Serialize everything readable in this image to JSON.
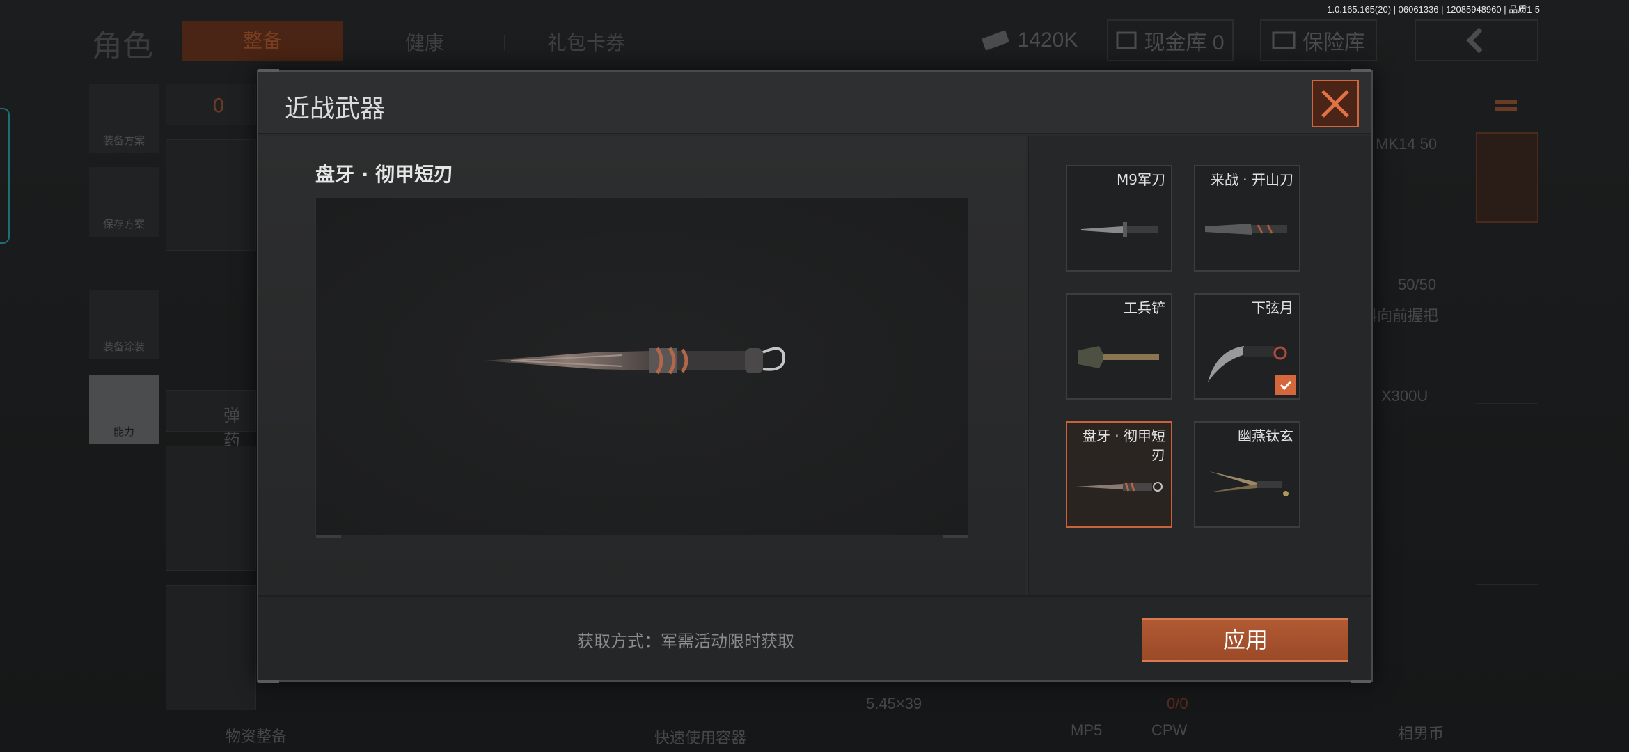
{
  "status_bar": {
    "version": "1.0.165.165(20) | 06061336 | 12085948960 | 品质1-5"
  },
  "background": {
    "page_title": "角色",
    "tabs": [
      "整备",
      "健康",
      "礼包卡券"
    ],
    "currency": {
      "amount": "1420K"
    },
    "cash_vault": "现金库 0",
    "safe": "保险库",
    "side_buttons": [
      "装备方案",
      "保存方案",
      "装备涂装",
      "能力"
    ],
    "vest_count": "0",
    "ammo_label": "弹药",
    "right_labels": {
      "mk14": "MK14 50",
      "ammo_count": "50/50",
      "grip": "斜向前握把",
      "x300": "X300U",
      "caliber": "5.45×39",
      "zero": "0/0",
      "mp5": "MP5",
      "cpw": "CPW",
      "bottom_left": "物资整备",
      "bottom_mid": "快速使用容器",
      "bottom_right": "相男币"
    }
  },
  "modal": {
    "title": "近战武器",
    "preview_name": "盘牙 · 彻甲短刃",
    "items": [
      {
        "name": "M9军刀",
        "selected": false,
        "equipped": false,
        "icon": "bayonet-icon"
      },
      {
        "name": "来战 · 开山刀",
        "selected": false,
        "equipped": false,
        "icon": "machete-icon"
      },
      {
        "name": "工兵铲",
        "selected": false,
        "equipped": false,
        "icon": "shovel-icon"
      },
      {
        "name": "下弦月",
        "selected": false,
        "equipped": true,
        "icon": "karambit-icon"
      },
      {
        "name": "盘牙 · 彻甲短刃",
        "selected": true,
        "equipped": false,
        "icon": "stiletto-icon"
      },
      {
        "name": "幽燕钛玄",
        "selected": false,
        "equipped": false,
        "icon": "twin-blade-icon"
      }
    ],
    "acquire_text": "获取方式：军需活动限时获取",
    "apply_label": "应用"
  },
  "colors": {
    "accent": "#c8623a",
    "apply": "#a8532f",
    "check": "#d4683c"
  }
}
